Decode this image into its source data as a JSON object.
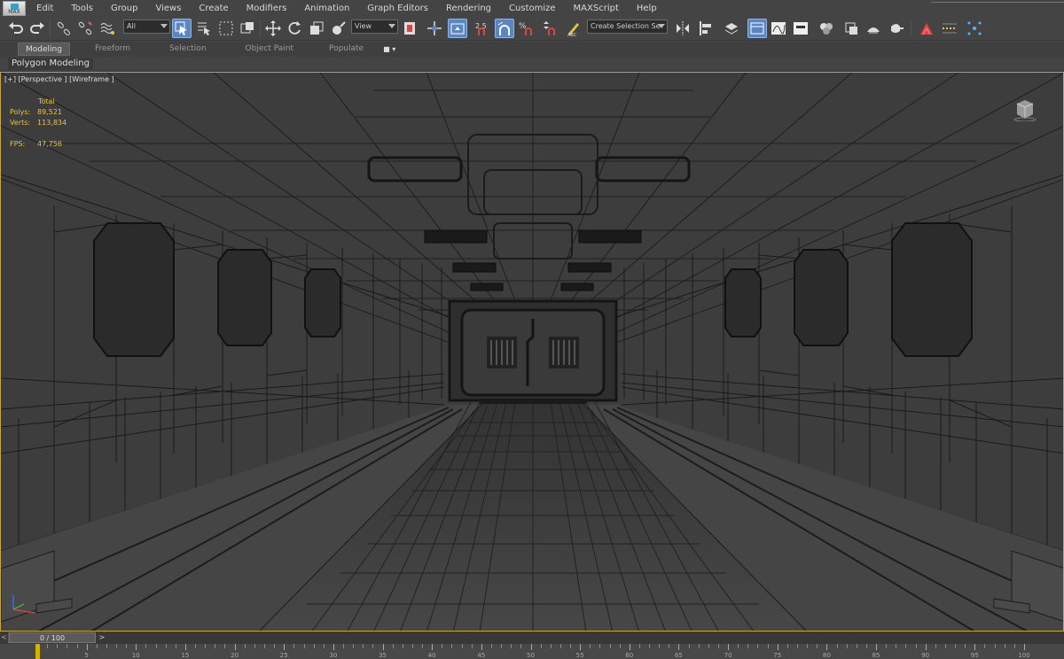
{
  "app": {
    "logo_text": "MAX",
    "accent": "#5a86c4",
    "viewport_border": "#c5a73a",
    "stats_color": "#e9c340"
  },
  "menu": [
    "Edit",
    "Tools",
    "Group",
    "Views",
    "Create",
    "Modifiers",
    "Animation",
    "Graph Editors",
    "Rendering",
    "Customize",
    "MAXScript",
    "Help"
  ],
  "toolbar": {
    "filter_value": "All",
    "refcoord_value": "View",
    "selection_set_placeholder": "Create Selection Se",
    "snaps": {
      "snap": "2.5",
      "angle": "A",
      "percent": "%"
    }
  },
  "ribbon": {
    "tabs": [
      "Modeling",
      "Freeform",
      "Selection",
      "Object Paint",
      "Populate"
    ],
    "active_tab": "Modeling",
    "panel_label": "Polygon Modeling"
  },
  "viewport": {
    "label": "[+] [Perspective ] [Wireframe ]",
    "stats": {
      "header": "Total",
      "polys_label": "Polys:",
      "polys": "89,521",
      "verts_label": "Verts:",
      "verts": "113,834",
      "fps_label": "FPS:",
      "fps": "47,756"
    }
  },
  "timeline": {
    "frame_display": "0 / 100",
    "left_arrow": "<",
    "right_arrow": ">",
    "current_frame": 0
  },
  "ruler": {
    "labels": [
      "5",
      "10",
      "15",
      "20",
      "25",
      "30",
      "35",
      "40",
      "45",
      "50",
      "55",
      "60",
      "65",
      "70",
      "75",
      "80",
      "85",
      "90",
      "95",
      "100"
    ]
  }
}
